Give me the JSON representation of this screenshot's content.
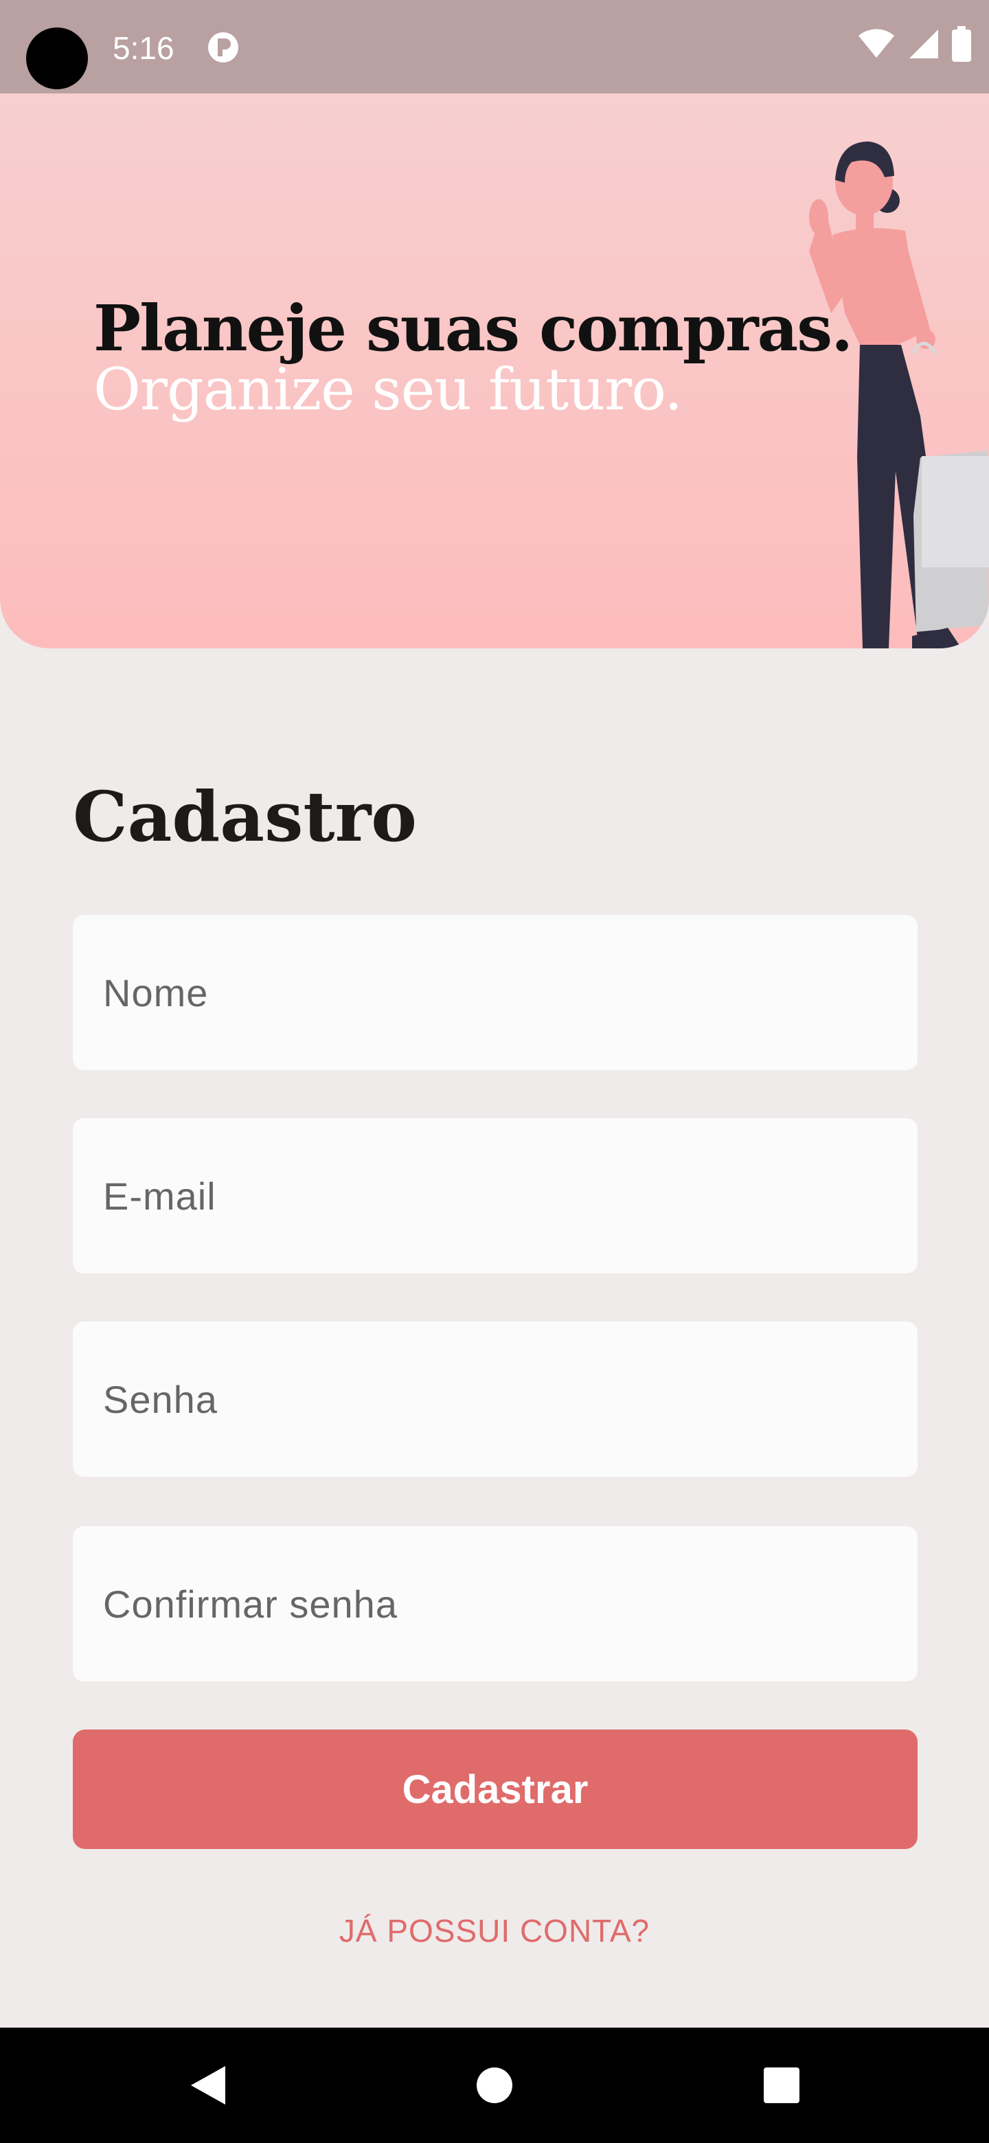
{
  "status_bar": {
    "time": "5:16",
    "app_icon": "pocket-icon",
    "right_icons": [
      "wifi-icon",
      "signal-icon",
      "battery-icon"
    ]
  },
  "hero": {
    "line1": "Planeje suas compras.",
    "line2": "Organize seu futuro.",
    "illustration": "woman-with-shopping-bag-illustration"
  },
  "form": {
    "title": "Cadastro",
    "fields": [
      {
        "placeholder": "Nome",
        "value": ""
      },
      {
        "placeholder": "E-mail",
        "value": ""
      },
      {
        "placeholder": "Senha",
        "value": ""
      },
      {
        "placeholder": "Confirmar senha",
        "value": ""
      }
    ],
    "submit_label": "Cadastrar",
    "login_link": "JÁ POSSUI CONTA?"
  },
  "nav_bar": {
    "buttons": [
      "back-icon",
      "home-icon",
      "recents-icon"
    ]
  },
  "colors": {
    "accent": "#df6b6b",
    "background": "#efebea",
    "status_bar": "#b9a1a1",
    "hero_top": "#f7cfcf",
    "hero_bottom": "#fdbcbc"
  }
}
